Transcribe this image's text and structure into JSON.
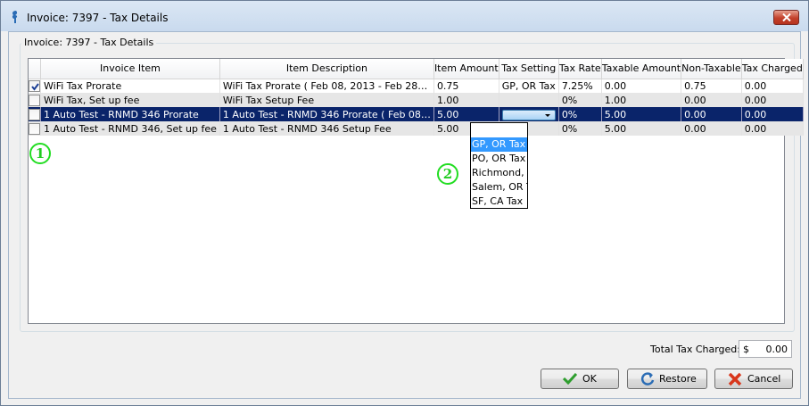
{
  "window": {
    "title": "Invoice: 7397 - Tax Details"
  },
  "group": {
    "label": "Invoice: 7397 - Tax Details"
  },
  "grid": {
    "columns": [
      "Invoice Item",
      "Item Description",
      "Item Amount",
      "Tax Setting",
      "Tax Rate",
      "Taxable Amount",
      "Non-Taxable",
      "Tax Charged"
    ],
    "rows": [
      {
        "checked": true,
        "cells": [
          "WiFi Tax Prorate",
          "WiFi Tax Prorate ( Feb 08, 2013 - Feb 28…",
          "0.75",
          "GP, OR Tax",
          "7.25%",
          "0.00",
          "0.75",
          "0.00"
        ]
      },
      {
        "checked": false,
        "cells": [
          "WiFi Tax, Set up fee",
          "WiFi Tax Setup Fee",
          "1.00",
          "",
          "0%",
          "1.00",
          "0.00",
          "0.00"
        ]
      },
      {
        "checked": false,
        "cells": [
          "1 Auto Test - RNMD 346 Prorate",
          "1 Auto Test - RNMD 346 Prorate ( Feb 08…",
          "5.00",
          "",
          "0%",
          "5.00",
          "0.00",
          "0.00"
        ]
      },
      {
        "checked": false,
        "cells": [
          "1 Auto Test - RNMD 346, Set up fee",
          "1 Auto Test - RNMD 346 Setup Fee",
          "5.00",
          "",
          "0%",
          "5.00",
          "0.00",
          "0.00"
        ]
      }
    ]
  },
  "dropdown": {
    "options": [
      "",
      "GP, OR Tax",
      "PO, OR Tax",
      "Richmond, VA Tax",
      "Salem, OR Tax",
      "SF, CA Tax"
    ],
    "highlighted": "GP, OR Tax"
  },
  "annotations": {
    "one": "1",
    "two": "2"
  },
  "totals": {
    "label": "Total Tax Charged:",
    "currency": "$",
    "value": "0.00"
  },
  "buttons": {
    "ok": "OK",
    "restore": "Restore",
    "cancel": "Cancel"
  },
  "colors": {
    "selection": "#0a246a",
    "highlight": "#3399ff",
    "annotation": "#22dd22"
  }
}
